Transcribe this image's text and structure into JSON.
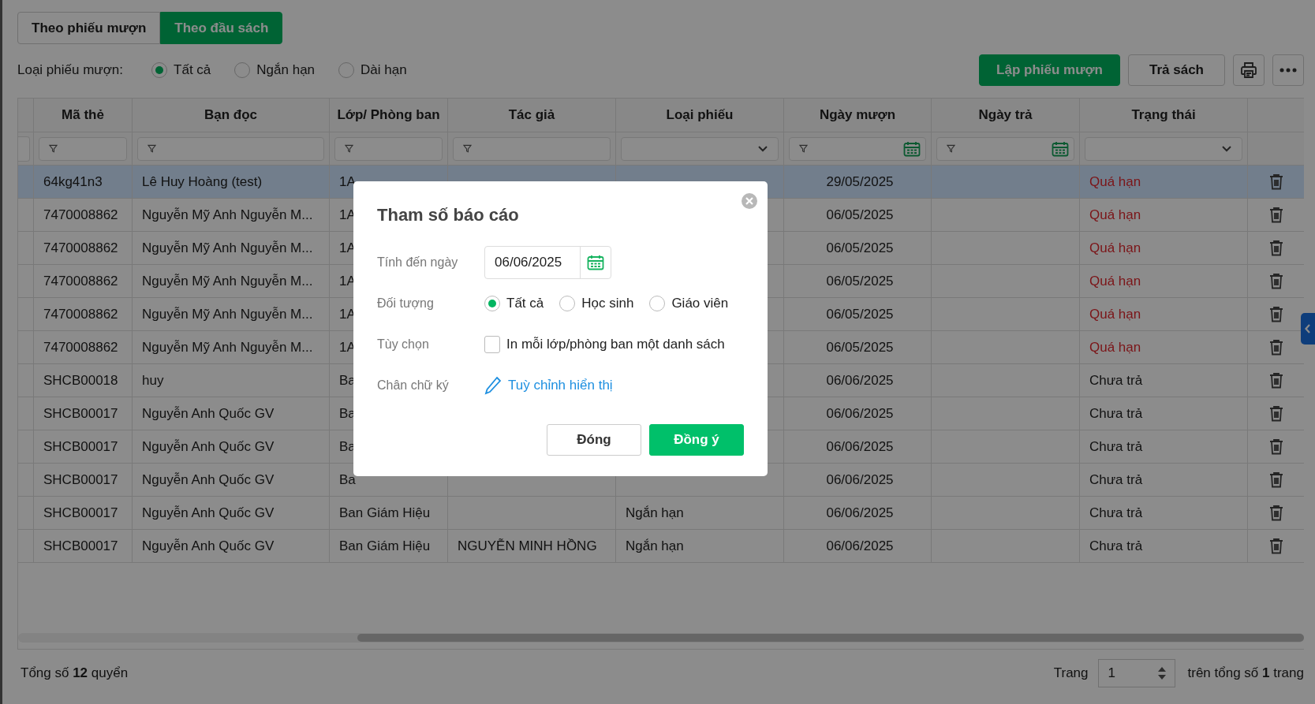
{
  "tabs": [
    {
      "label": "Theo phiếu mượn",
      "selected": false
    },
    {
      "label": "Theo đầu sách",
      "selected": true
    }
  ],
  "loan_type": {
    "label": "Loại phiếu mượn:",
    "options": [
      {
        "label": "Tất cả",
        "selected": true
      },
      {
        "label": "Ngắn hạn",
        "selected": false
      },
      {
        "label": "Dài hạn",
        "selected": false
      }
    ]
  },
  "actions": {
    "create": "Lập phiếu mượn",
    "return": "Trả sách"
  },
  "table": {
    "columns": [
      {
        "label": "Mã thẻ",
        "kind": "text"
      },
      {
        "label": "Bạn đọc",
        "kind": "text"
      },
      {
        "label": "Lớp/ Phòng ban",
        "kind": "text"
      },
      {
        "label": "Tác giả",
        "kind": "text"
      },
      {
        "label": "Loại phiếu",
        "kind": "select"
      },
      {
        "label": "Ngày mượn",
        "kind": "date"
      },
      {
        "label": "Ngày trả",
        "kind": "date"
      },
      {
        "label": "Trạng thái",
        "kind": "select"
      }
    ],
    "rows": [
      {
        "selected": true,
        "overdue": true,
        "card": "64kg41n3",
        "reader": "Lê Huy Hoàng (test)",
        "class": "1A",
        "borrowed": "29/05/2025",
        "status": "Quá hạn"
      },
      {
        "selected": false,
        "overdue": true,
        "card": "7470008862",
        "reader": "Nguyễn Mỹ Anh Nguyễn M...",
        "class": "1A",
        "borrowed": "06/05/2025",
        "status": "Quá hạn"
      },
      {
        "selected": false,
        "overdue": true,
        "card": "7470008862",
        "reader": "Nguyễn Mỹ Anh Nguyễn M...",
        "class": "1A",
        "borrowed": "06/05/2025",
        "status": "Quá hạn"
      },
      {
        "selected": false,
        "overdue": true,
        "card": "7470008862",
        "reader": "Nguyễn Mỹ Anh Nguyễn M...",
        "class": "1A",
        "borrowed": "06/05/2025",
        "status": "Quá hạn"
      },
      {
        "selected": false,
        "overdue": true,
        "card": "7470008862",
        "reader": "Nguyễn Mỹ Anh Nguyễn M...",
        "class": "1A",
        "borrowed": "06/05/2025",
        "status": "Quá hạn"
      },
      {
        "selected": false,
        "overdue": true,
        "card": "7470008862",
        "reader": "Nguyễn Mỹ Anh Nguyễn M...",
        "class": "1A",
        "borrowed": "06/05/2025",
        "status": "Quá hạn"
      },
      {
        "selected": false,
        "overdue": false,
        "card": "SHCB00018",
        "reader": "huy",
        "class": "Ba",
        "borrowed": "06/06/2025",
        "status": "Chưa trả"
      },
      {
        "selected": false,
        "overdue": false,
        "card": "SHCB00017",
        "reader": "Nguyễn Anh Quốc GV",
        "class": "Ba",
        "borrowed": "06/06/2025",
        "status": "Chưa trả"
      },
      {
        "selected": false,
        "overdue": false,
        "card": "SHCB00017",
        "reader": "Nguyễn Anh Quốc GV",
        "class": "Ba",
        "borrowed": "06/06/2025",
        "status": "Chưa trả"
      },
      {
        "selected": false,
        "overdue": false,
        "card": "SHCB00017",
        "reader": "Nguyễn Anh Quốc GV",
        "class": "Ba",
        "borrowed": "06/06/2025",
        "status": "Chưa trả"
      },
      {
        "selected": false,
        "overdue": false,
        "card": "SHCB00017",
        "reader": "Nguyễn Anh Quốc GV",
        "class": "Ban Giám Hiệu",
        "type": "Ngắn hạn",
        "borrowed": "06/06/2025",
        "status": "Chưa trả"
      },
      {
        "selected": false,
        "overdue": false,
        "card": "SHCB00017",
        "reader": "Nguyễn Anh Quốc GV",
        "class": "Ban Giám Hiệu",
        "author": "NGUYỄN MINH HỒNG",
        "type": "Ngắn hạn",
        "borrowed": "06/06/2025",
        "status": "Chưa trả"
      }
    ]
  },
  "footer": {
    "total": "Tổng số **12** quyển",
    "page_label": "Trang",
    "page": "1",
    "page_total": "trên tổng số **1** trang"
  },
  "dialog": {
    "title": "Tham số báo cáo",
    "fields": [
      {
        "kind": "date",
        "label": "Tính đến ngày",
        "value": "06/06/2025"
      },
      {
        "kind": "radio",
        "label": "Đối tượng",
        "options": [
          {
            "label": "Tất cả",
            "selected": true
          },
          {
            "label": "Học sinh",
            "selected": false
          },
          {
            "label": "Giáo viên",
            "selected": false
          }
        ]
      },
      {
        "kind": "checkbox",
        "label": "Tùy chọn",
        "text": "In mỗi lớp/phòng ban một danh sách",
        "checked": false
      },
      {
        "kind": "link",
        "label": "Chân chữ ký",
        "text": "Tuỳ chỉnh hiển thị"
      }
    ],
    "buttons": {
      "cancel": "Đóng",
      "ok": "Đồng ý"
    }
  }
}
